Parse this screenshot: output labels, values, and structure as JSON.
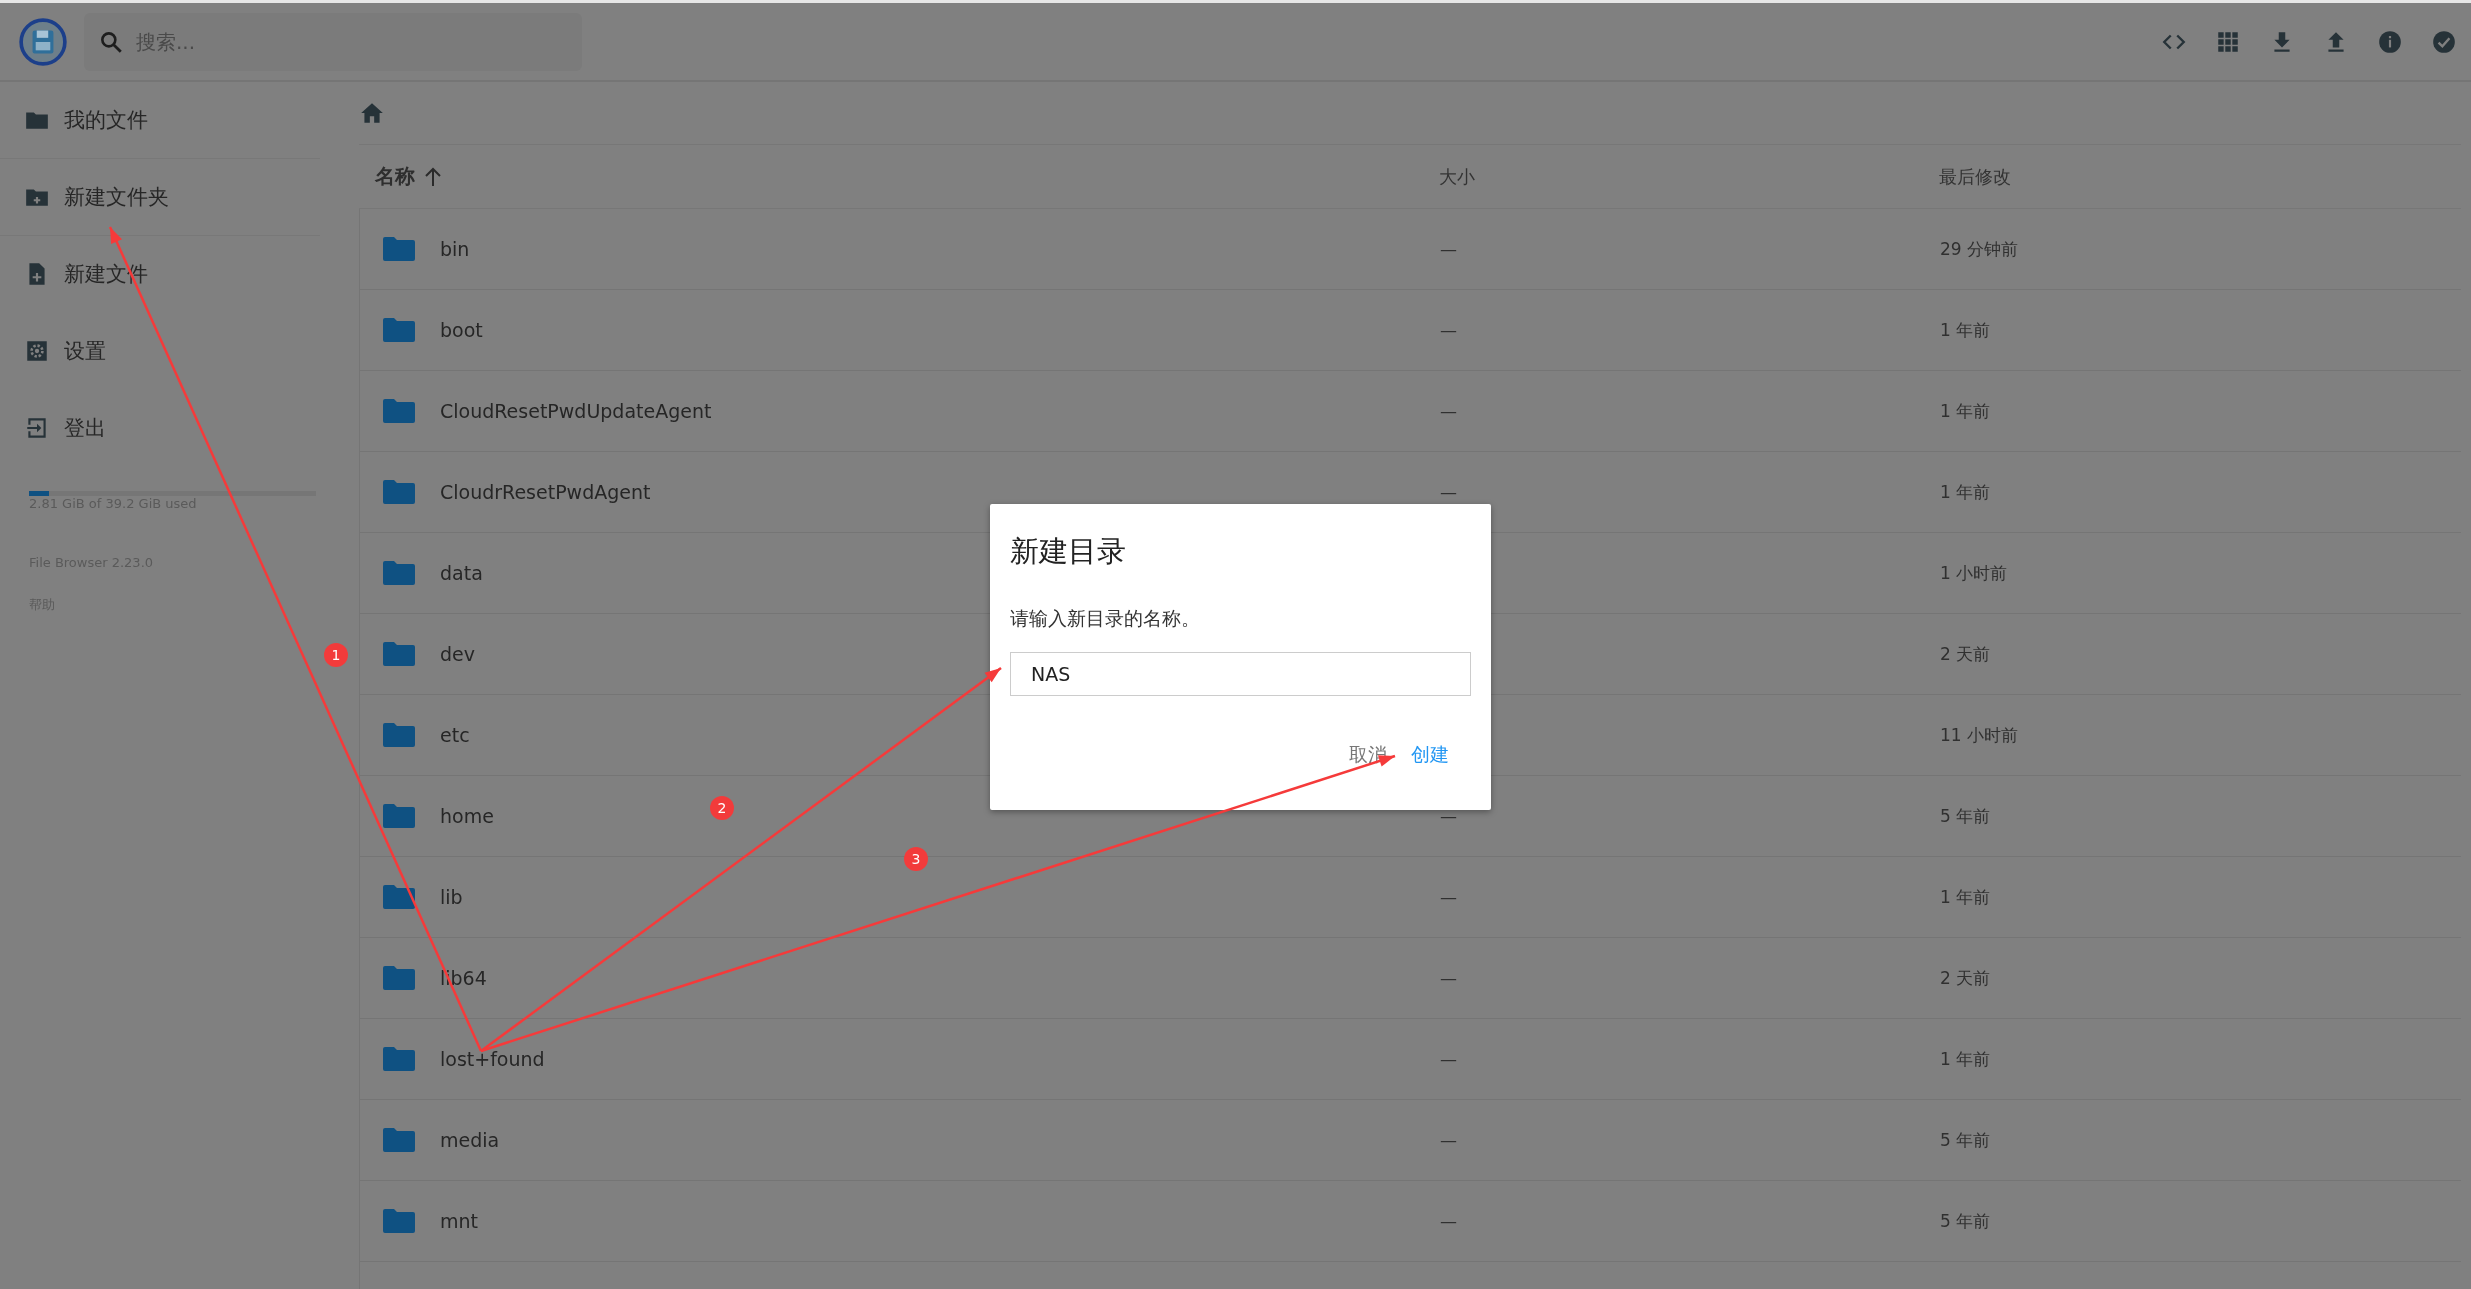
{
  "header": {
    "search": {
      "placeholder": "搜索..."
    }
  },
  "sidebar": {
    "items": [
      {
        "label": "我的文件"
      },
      {
        "label": "新建文件夹"
      },
      {
        "label": "新建文件"
      },
      {
        "label": "设置"
      },
      {
        "label": "登出"
      }
    ],
    "storage": {
      "level": 0.07,
      "text": "2.81 GiB of 39.2 GiB used"
    },
    "version": "File Browser 2.23.0",
    "help": "帮助"
  },
  "table": {
    "columns": [
      {
        "label": "名称",
        "sorted": true
      },
      {
        "label": "大小",
        "sorted": false
      },
      {
        "label": "最后修改",
        "sorted": false
      }
    ],
    "rows": [
      {
        "name": "bin",
        "size": "—",
        "modified": "29 分钟前"
      },
      {
        "name": "boot",
        "size": "—",
        "modified": "1 年前"
      },
      {
        "name": "CloudResetPwdUpdateAgent",
        "size": "—",
        "modified": "1 年前"
      },
      {
        "name": "CloudrResetPwdAgent",
        "size": "—",
        "modified": "1 年前"
      },
      {
        "name": "data",
        "modified": "1 小时前"
      },
      {
        "name": "dev",
        "modified": "2 天前"
      },
      {
        "name": "etc",
        "modified": "11 小时前"
      },
      {
        "name": "home",
        "size": "—",
        "modified": "5 年前"
      },
      {
        "name": "lib",
        "size": "—",
        "modified": "1 年前"
      },
      {
        "name": "lib64",
        "size": "—",
        "modified": "2 天前"
      },
      {
        "name": "lost+found",
        "size": "—",
        "modified": "1 年前"
      },
      {
        "name": "media",
        "size": "—",
        "modified": "5 年前"
      },
      {
        "name": "mnt",
        "size": "—",
        "modified": "5 年前"
      }
    ]
  },
  "dialog": {
    "title": "新建目录",
    "message": "请输入新目录的名称。",
    "input": {
      "value": "NAS"
    },
    "buttons": [
      {
        "label": "取消",
        "kind": "secondary"
      },
      {
        "label": "创建",
        "kind": "primary"
      }
    ]
  },
  "annotations": [
    {
      "number": "1"
    },
    {
      "number": "2"
    },
    {
      "number": "3"
    }
  ]
}
